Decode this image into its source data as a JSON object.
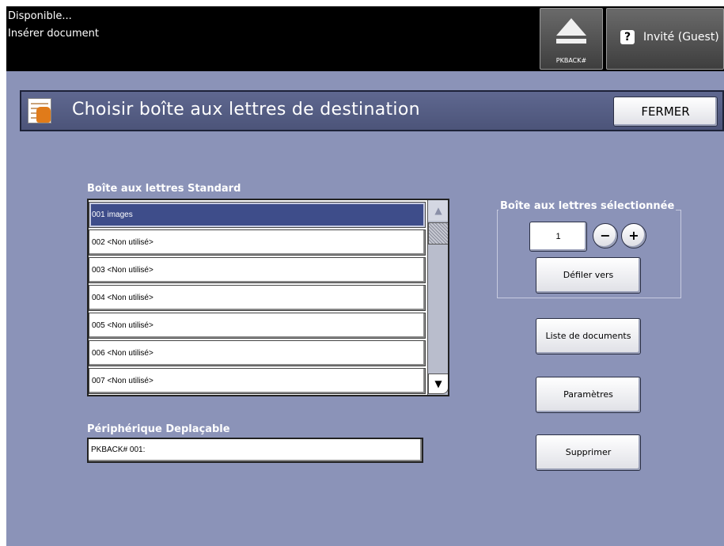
{
  "status": {
    "line1": "Disponible...",
    "line2": "Insérer document"
  },
  "top_buttons": {
    "eject_label": "PKBACK#",
    "guest_label": "Invité (Guest)",
    "guest_icon": "?"
  },
  "header": {
    "icon": "hand-pointer-icon",
    "title": "Choisir boîte aux lettres de destination",
    "close_label": "FERMER"
  },
  "mailbox_list": {
    "label": "Boîte aux lettres Standard",
    "rows": [
      {
        "num": "001",
        "name": "images",
        "selected": true
      },
      {
        "num": "002",
        "name": "<Non utilisé>",
        "selected": false
      },
      {
        "num": "003",
        "name": "<Non utilisé>",
        "selected": false
      },
      {
        "num": "004",
        "name": "<Non utilisé>",
        "selected": false
      },
      {
        "num": "005",
        "name": "<Non utilisé>",
        "selected": false
      },
      {
        "num": "006",
        "name": "<Non utilisé>",
        "selected": false
      },
      {
        "num": "007",
        "name": "<Non utilisé>",
        "selected": false
      }
    ]
  },
  "device": {
    "label": "Périphérique Deplaçable",
    "value": "PKBACK# 001:"
  },
  "selected_mailbox": {
    "legend": "Boîte aux lettres sélectionnée",
    "value": "1",
    "minus": "−",
    "plus": "+",
    "scroll_to_label": "Défiler vers"
  },
  "actions": {
    "doc_list_label": "Liste de documents",
    "params_label": "Paramètres",
    "delete_label": "Supprimer"
  },
  "colors": {
    "background": "#8b93b8",
    "header": "#4c5479",
    "selected_row": "#3e4d8a",
    "topbar": "#000000"
  }
}
